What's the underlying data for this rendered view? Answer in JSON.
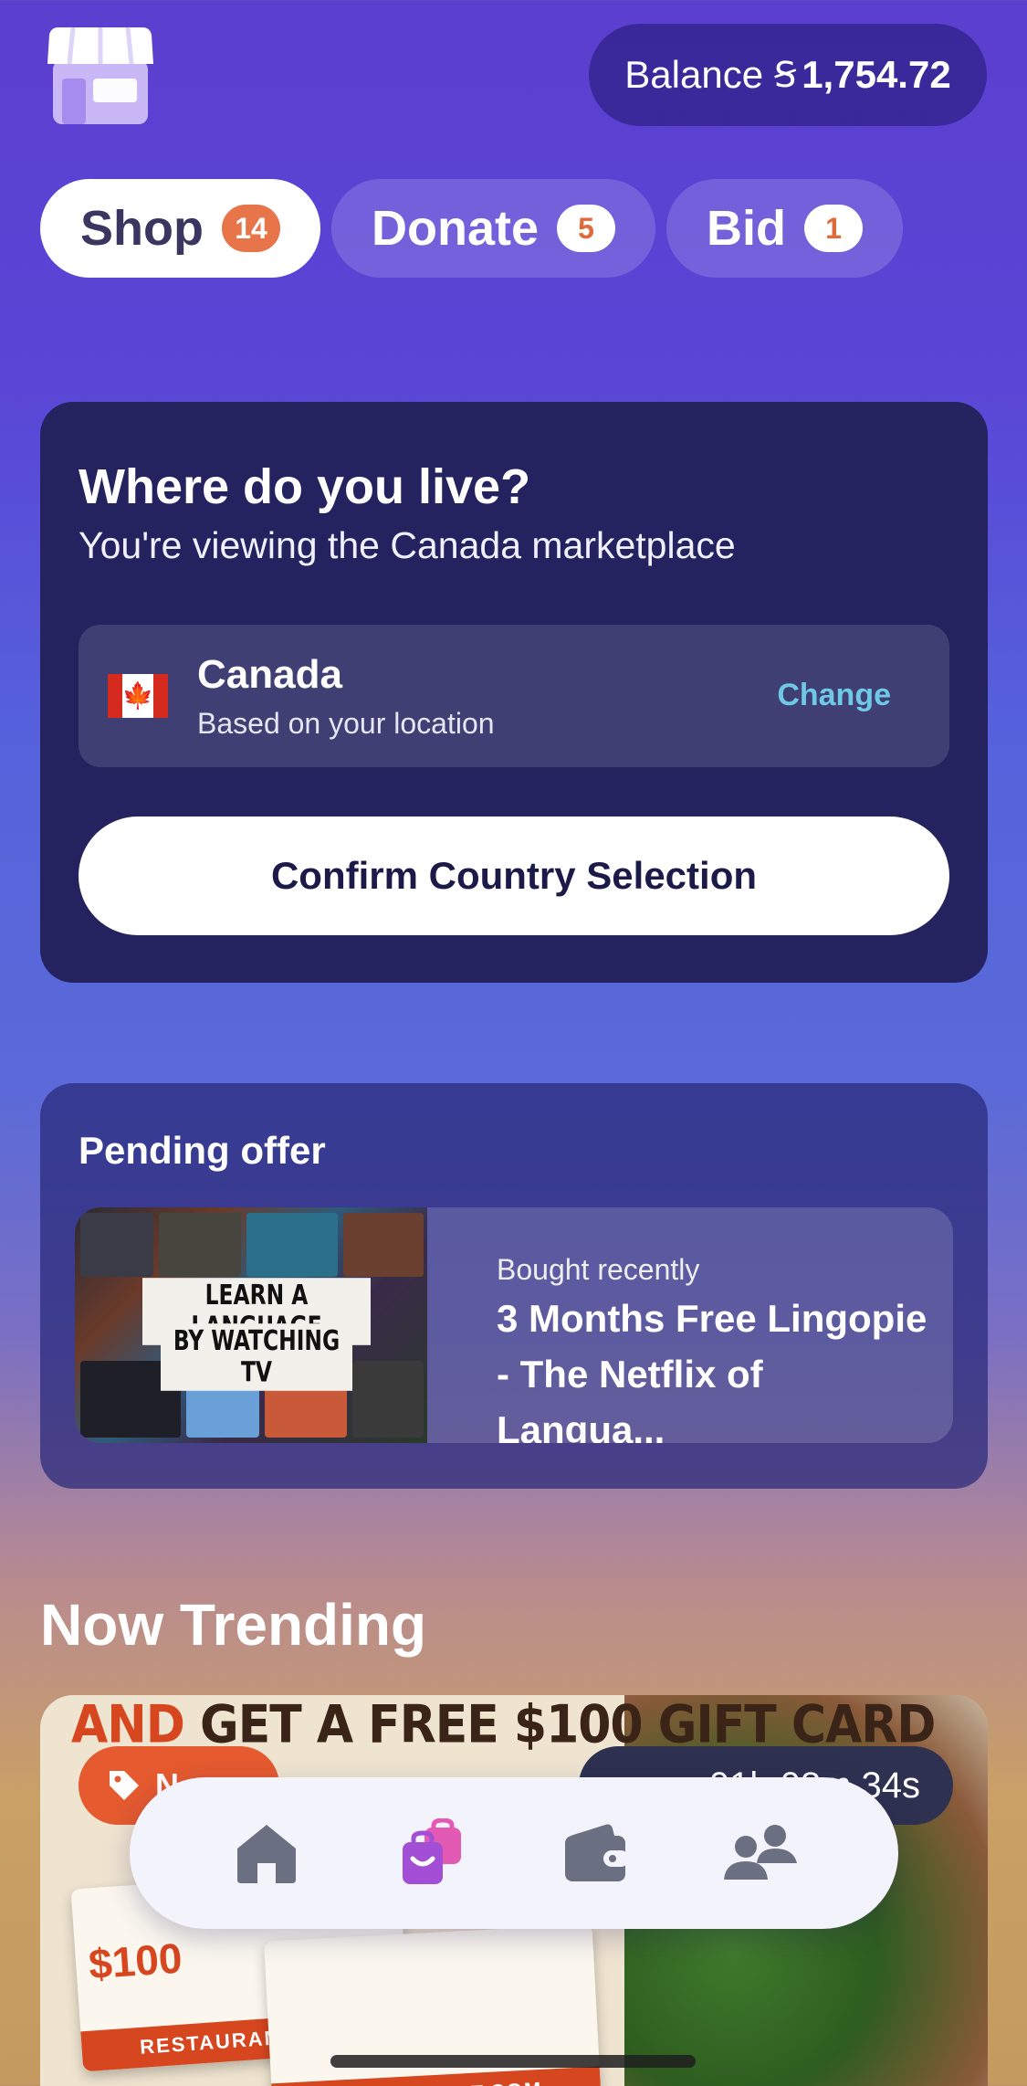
{
  "header": {
    "balance_label": "Balance",
    "balance_coin": "Ꞩ",
    "balance_value": "1,754.72"
  },
  "tabs": [
    {
      "label": "Shop",
      "count": "14",
      "active": true
    },
    {
      "label": "Donate",
      "count": "5",
      "active": false
    },
    {
      "label": "Bid",
      "count": "1",
      "active": false
    }
  ],
  "location_card": {
    "title": "Where do you live?",
    "subtitle": "You're viewing the Canada marketplace",
    "country": "Canada",
    "country_hint": "Based on your location",
    "flag_glyph": "🍁",
    "change_label": "Change",
    "confirm_label": "Confirm Country Selection"
  },
  "pending_offer": {
    "title": "Pending offer",
    "kicker": "Bought recently",
    "name": "3 Months Free Lingopie - The Netflix of Langua...",
    "thumb_caption_line1": "LEARN A LANGUAGE",
    "thumb_caption_line2": "BY WATCHING TV"
  },
  "trending": {
    "title": "Now Trending",
    "promo": {
      "headline_highlight": "AND",
      "headline_rest": "GET A FREE $100 GIFT CARD",
      "badge_label": "N",
      "timer_text": "01h 08m 34s",
      "gift_amount": "$100",
      "gift_brand": "RESTAURANT.COM"
    }
  },
  "bottom_nav": {
    "items": [
      {
        "icon": "home-icon"
      },
      {
        "icon": "shopping-bags-icon",
        "active": true
      },
      {
        "icon": "wallet-icon"
      },
      {
        "icon": "people-icon"
      }
    ]
  },
  "colors": {
    "accent_orange": "#e8744a",
    "link_cyan": "#6ec8e6",
    "card_dark": "#24235f",
    "nav_active": "#a24fd6"
  }
}
